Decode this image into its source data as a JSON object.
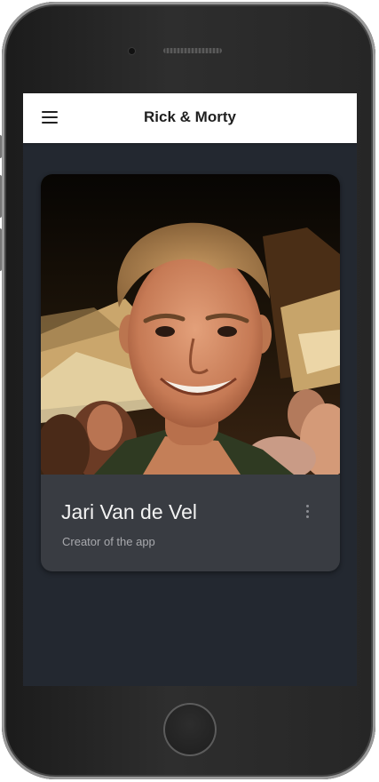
{
  "app": {
    "title": "Rick & Morty",
    "menu_icon": "hamburger-menu-icon"
  },
  "card": {
    "name": "Jari Van de Vel",
    "subtitle": "Creator of the app",
    "photo_description_icon": "profile-photo",
    "more_icon": "more-vert-icon"
  },
  "colors": {
    "screen_background": "#232830",
    "appbar_background": "#ffffff",
    "card_background": "#393c42",
    "name_text": "#f3f3f3",
    "subtitle_text": "#a8a9ad"
  }
}
